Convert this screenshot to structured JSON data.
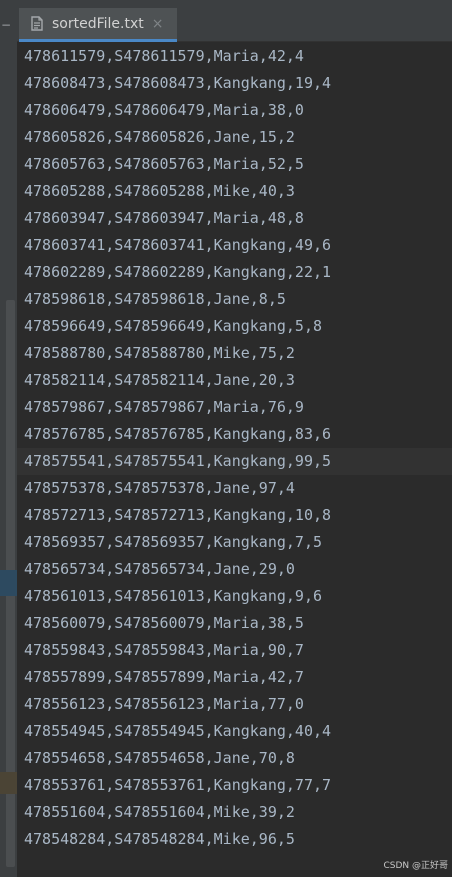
{
  "tab": {
    "title": "sortedFile.txt",
    "close_glyph": "×",
    "file_icon": "text-file-icon"
  },
  "sidebar": {
    "collapse_glyph": "−"
  },
  "editor": {
    "current_line_index": 15,
    "lines": [
      "478611579,S478611579,Maria,42,4",
      "478608473,S478608473,Kangkang,19,4",
      "478606479,S478606479,Maria,38,0",
      "478605826,S478605826,Jane,15,2",
      "478605763,S478605763,Maria,52,5",
      "478605288,S478605288,Mike,40,3",
      "478603947,S478603947,Maria,48,8",
      "478603741,S478603741,Kangkang,49,6",
      "478602289,S478602289,Kangkang,22,1",
      "478598618,S478598618,Jane,8,5",
      "478596649,S478596649,Kangkang,5,8",
      "478588780,S478588780,Mike,75,2",
      "478582114,S478582114,Jane,20,3",
      "478579867,S478579867,Maria,76,9",
      "478576785,S478576785,Kangkang,83,6",
      "478575541,S478575541,Kangkang,99,5",
      "478575378,S478575378,Jane,97,4",
      "478572713,S478572713,Kangkang,10,8",
      "478569357,S478569357,Kangkang,7,5",
      "478565734,S478565734,Jane,29,0",
      "478561013,S478561013,Kangkang,9,6",
      "478560079,S478560079,Maria,38,5",
      "478559843,S478559843,Maria,90,7",
      "478557899,S478557899,Maria,42,7",
      "478556123,S478556123,Maria,77,0",
      "478554945,S478554945,Kangkang,40,4",
      "478554658,S478554658,Jane,70,8",
      "478553761,S478553761,Kangkang,77,7",
      "478551604,S478551604,Mike,39,2",
      "478548284,S478548284,Mike,96,5"
    ]
  },
  "watermark": "CSDN @正好哥",
  "colors": {
    "editor_bg": "#2b2b2b",
    "text": "#a9b7c6",
    "current_line": "#323232",
    "tab_bg": "#4e5254",
    "tab_accent": "#4a88c7"
  }
}
